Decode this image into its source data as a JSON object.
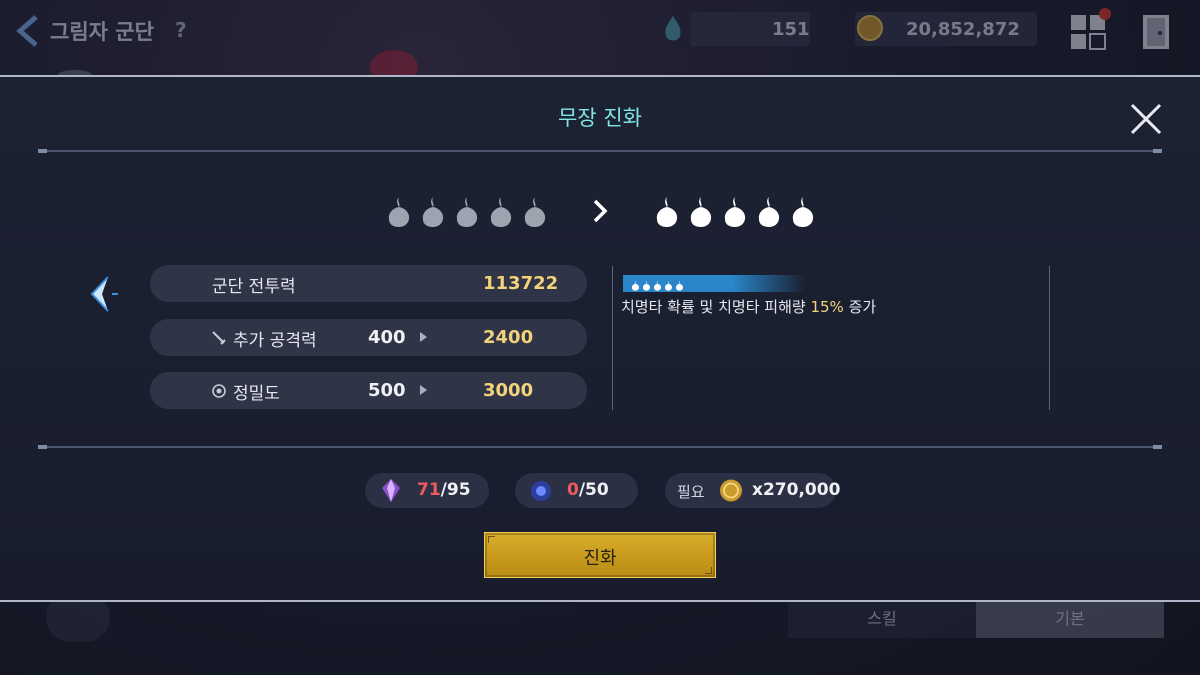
{
  "hud": {
    "title": "그림자 군단",
    "help": "?",
    "stamina": "151",
    "gold": "20,852,872"
  },
  "background_tabs": {
    "skill": "스킬",
    "basic": "기본"
  },
  "dialog": {
    "title": "무장 진화",
    "current_stars": 5,
    "next_stars": 5,
    "stats": [
      {
        "label": "군단 전투력",
        "value": "113722"
      },
      {
        "label": "추가 공격력",
        "old": "400",
        "new": "2400"
      },
      {
        "label": "정밀도",
        "old": "500",
        "new": "3000"
      }
    ],
    "description": {
      "stars": 5,
      "text_before": "치명타 확률 및 치명타 피해량 ",
      "highlight": "15%",
      "text_after": " 증가"
    },
    "materials": [
      {
        "have": "71",
        "need": "/95"
      },
      {
        "have": "0",
        "need": "/50"
      }
    ],
    "cost": {
      "label": "필요",
      "amount": "x270,000"
    },
    "evolve_button": "진화"
  },
  "colors": {
    "title": "#7fe6e6",
    "highlight": "#f3d37a",
    "insufficient": "#ef5a5a",
    "button": "#c79a1d"
  }
}
